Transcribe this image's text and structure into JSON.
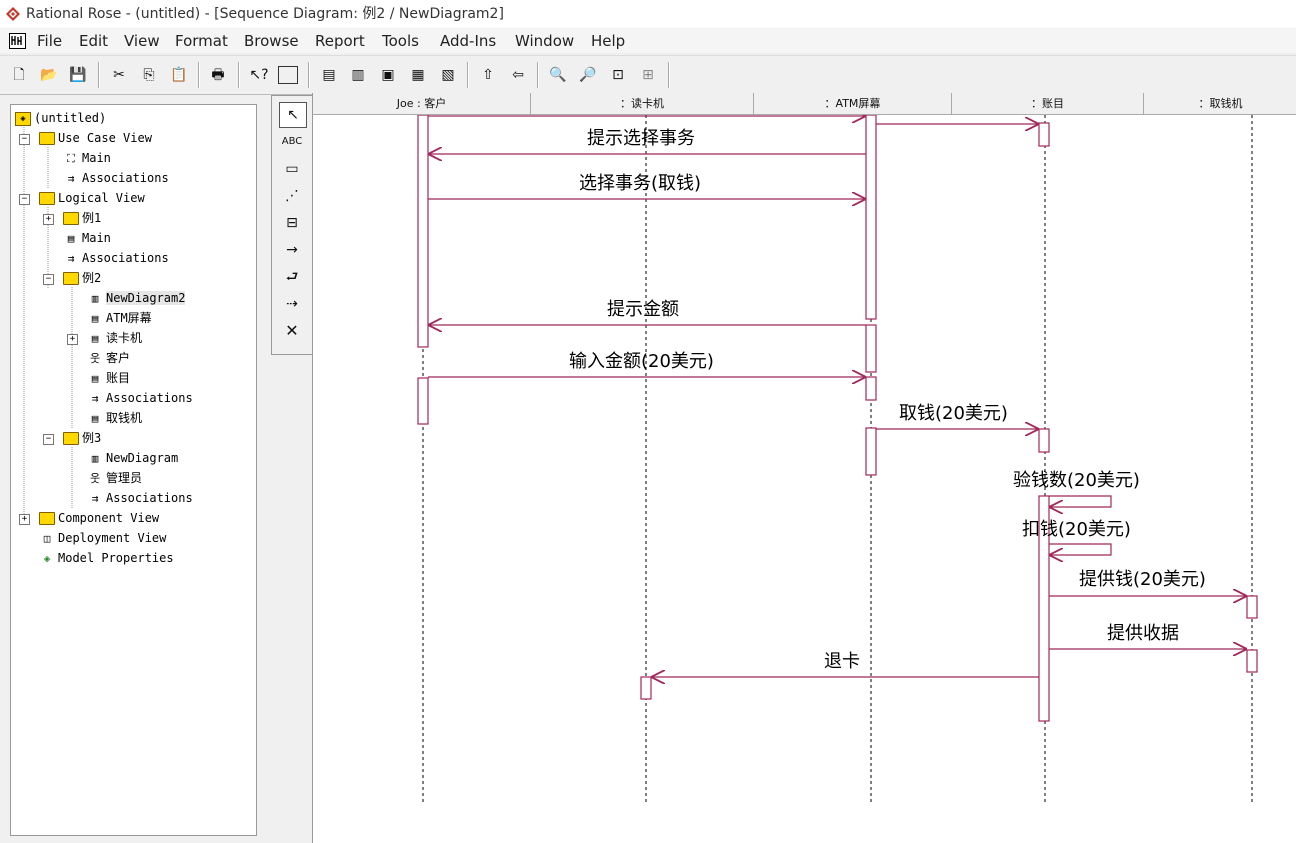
{
  "window": {
    "title": "Rational Rose - (untitled) - [Sequence Diagram: 例2 / NewDiagram2]"
  },
  "menu": [
    "File",
    "Edit",
    "View",
    "Format",
    "Browse",
    "Report",
    "Tools",
    "Add-Ins",
    "Window",
    "Help"
  ],
  "toolbar": {
    "buttons": [
      "new-icon",
      "open-icon",
      "save-icon",
      "cut-icon",
      "copy-icon",
      "paste-icon",
      "print-icon",
      "context-help-icon",
      "view-doc-icon",
      "class-diagram-icon",
      "interaction-diagram-icon",
      "component-diagram-icon",
      "state-diagram-icon",
      "deployment-diagram-icon",
      "parent-diagram-icon",
      "previous-diagram-icon",
      "zoom-in-icon",
      "zoom-out-icon",
      "fit-window-icon",
      "undo-fit-icon"
    ]
  },
  "browser": {
    "root": "(untitled)",
    "use_case_view": "Use Case View",
    "ucv_main": "Main",
    "ucv_assoc": "Associations",
    "logical_view": "Logical View",
    "pkg1": "例1",
    "lv_main": "Main",
    "lv_assoc": "Associations",
    "pkg2": "例2",
    "p2_diagram": "NewDiagram2",
    "p2_atm": "ATM屏幕",
    "p2_reader": "读卡机",
    "p2_customer": "客户",
    "p2_account": "账目",
    "p2_assoc": "Associations",
    "p2_dispenser": "取钱机",
    "pkg3": "例3",
    "p3_diagram": "NewDiagram",
    "p3_admin": "管理员",
    "p3_assoc": "Associations",
    "component_view": "Component View",
    "deployment_view": "Deployment View",
    "model_properties": "Model Properties"
  },
  "palette": {
    "text_tool": "ABC",
    "delete_tool": "✕"
  },
  "diagram": {
    "objects": [
      "Joe : 客户",
      "：读卡机",
      "：ATM屏幕",
      "：账目",
      "：取钱机"
    ],
    "messages": {
      "m1": "提示选择事务",
      "m2": "选择事务(取钱)",
      "m3": "提示金额",
      "m4": "输入金额(20美元)",
      "m5": "取钱(20美元)",
      "m6": "验钱数(20美元)",
      "m7": "扣钱(20美元)",
      "m8": "提供钱(20美元)",
      "m9": "提供收据",
      "m10": "退卡"
    },
    "colors": {
      "message": "#a0285a",
      "lifeline": "#000000"
    }
  }
}
